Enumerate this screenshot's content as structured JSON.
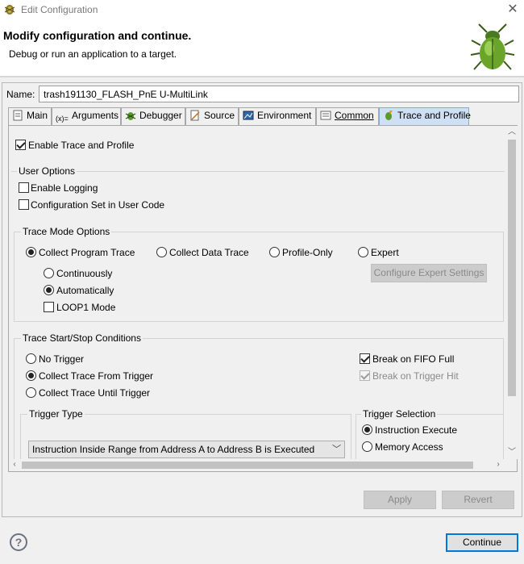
{
  "window": {
    "title": "Edit Configuration"
  },
  "header": {
    "title": "Modify configuration and continue.",
    "subtitle": "Debug or run an application to a target."
  },
  "name_field": {
    "label": "Name:",
    "value": "trash191130_FLASH_PnE U-MultiLink"
  },
  "tabs": [
    {
      "label": "Main",
      "icon": "main-tab-icon"
    },
    {
      "label": "Arguments",
      "icon": "arguments-icon"
    },
    {
      "label": "Debugger",
      "icon": "debugger-bug-icon"
    },
    {
      "label": "Source",
      "icon": "source-icon"
    },
    {
      "label": "Environment",
      "icon": "environment-icon"
    },
    {
      "label": "Common",
      "icon": "common-icon"
    },
    {
      "label": "Trace and Profile",
      "icon": "trace-profile-icon",
      "active": true
    }
  ],
  "trace": {
    "enable_label": "Enable Trace and Profile",
    "enable_checked": true,
    "user_options": {
      "title": "User Options",
      "enable_logging": "Enable Logging",
      "config_set": "Configuration Set in User Code"
    },
    "mode_options": {
      "title": "Trace Mode Options",
      "collect_program": "Collect Program Trace",
      "collect_data": "Collect Data Trace",
      "profile_only": "Profile-Only",
      "expert": "Expert",
      "configure_expert": "Configure Expert Settings",
      "continuously": "Continuously",
      "automatically": "Automatically",
      "loop1": "LOOP1 Mode"
    },
    "start_stop": {
      "title": "Trace Start/Stop Conditions",
      "no_trigger": "No Trigger",
      "collect_from": "Collect Trace From Trigger",
      "collect_until": "Collect Trace Until Trigger",
      "break_fifo": "Break on FIFO Full",
      "break_trigger": "Break on Trigger Hit"
    },
    "trigger_type": {
      "title": "Trigger Type",
      "selected": "Instruction Inside Range from Address A to Address B is Executed"
    },
    "trigger_selection": {
      "title": "Trigger Selection",
      "instruction_execute": "Instruction Execute",
      "memory_access": "Memory Access"
    }
  },
  "buttons": {
    "apply": "Apply",
    "revert": "Revert",
    "continue": "Continue"
  },
  "help": {
    "symbol": "?"
  },
  "colors": {
    "accent": "#0078d7",
    "active_tab": "#cfe0f5"
  }
}
